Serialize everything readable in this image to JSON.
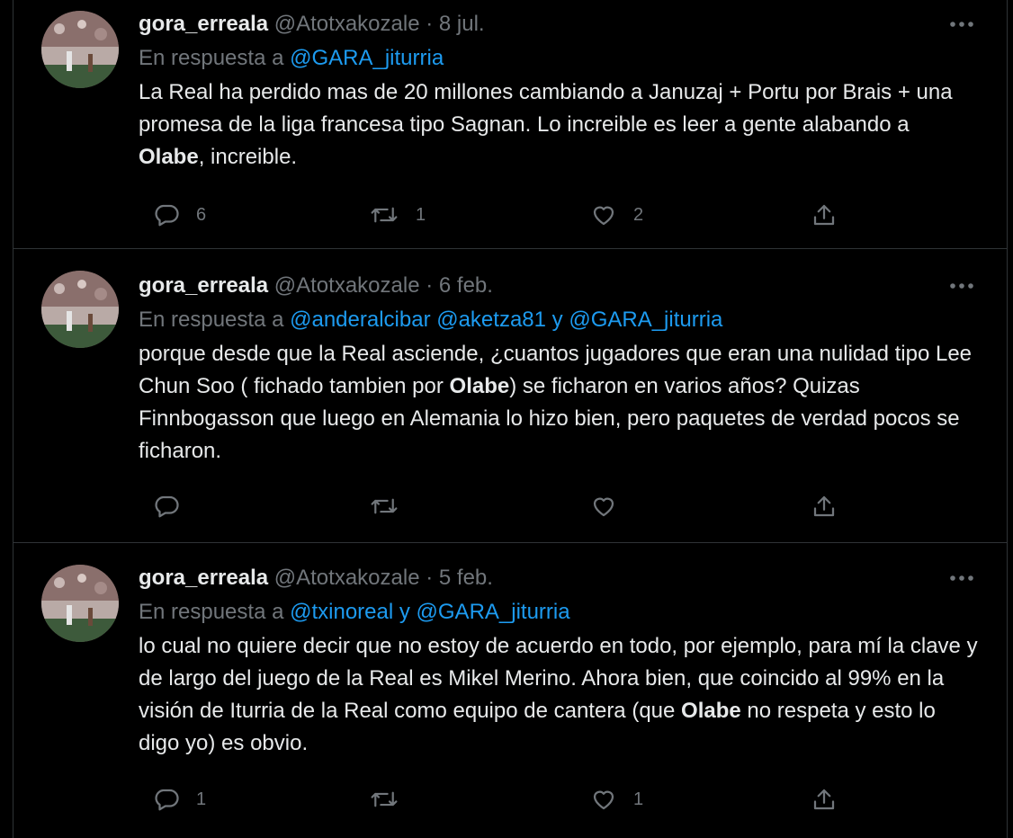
{
  "tweets": [
    {
      "display_name": "gora_erreala",
      "handle": "@Atotxakozale",
      "separator": "·",
      "date": "8 jul.",
      "reply_prefix": "En respuesta a",
      "reply_mentions": "@GARA_jiturria",
      "text_parts": [
        {
          "t": "La Real ha perdido mas de 20 millones cambiando a Januzaj + Portu por Brais + una promesa de la liga francesa tipo Sagnan. Lo increible es leer a gente alabando a ",
          "b": false
        },
        {
          "t": "Olabe",
          "b": true
        },
        {
          "t": ", increible.",
          "b": false
        }
      ],
      "reply_count": "6",
      "retweet_count": "1",
      "like_count": "2"
    },
    {
      "display_name": "gora_erreala",
      "handle": "@Atotxakozale",
      "separator": "·",
      "date": "6 feb.",
      "reply_prefix": "En respuesta a",
      "reply_mentions": "@anderalcibar @aketza81 y @GARA_jiturria",
      "text_parts": [
        {
          "t": "porque desde que la Real asciende, ¿cuantos jugadores que eran una nulidad tipo Lee Chun Soo ( fichado tambien por ",
          "b": false
        },
        {
          "t": "Olabe",
          "b": true
        },
        {
          "t": ") se ficharon en varios años? Quizas Finnbogasson que luego en Alemania lo hizo bien, pero paquetes de verdad pocos se ficharon.",
          "b": false
        }
      ],
      "reply_count": "",
      "retweet_count": "",
      "like_count": ""
    },
    {
      "display_name": "gora_erreala",
      "handle": "@Atotxakozale",
      "separator": "·",
      "date": "5 feb.",
      "reply_prefix": "En respuesta a",
      "reply_mentions": "@txinoreal y @GARA_jiturria",
      "text_parts": [
        {
          "t": "lo cual no quiere decir que no estoy de acuerdo en todo, por ejemplo, para mí la clave y de largo del juego de la Real es Mikel Merino. Ahora bien, que coincido al 99% en la visión de Iturria de la Real como equipo de cantera (que ",
          "b": false
        },
        {
          "t": "Olabe",
          "b": true
        },
        {
          "t": " no respeta y esto lo digo yo) es obvio.",
          "b": false
        }
      ],
      "reply_count": "1",
      "retweet_count": "",
      "like_count": "1"
    }
  ],
  "colors": {
    "background": "#000000",
    "text": "#e7e9ea",
    "secondary": "#71767b",
    "link": "#1d9bf0",
    "border": "#2f3336"
  },
  "icons": {
    "reply": "speech-bubble-icon",
    "retweet": "retweet-arrows-icon",
    "like": "heart-outline-icon",
    "share": "upload-share-icon",
    "more": "three-dots-icon"
  }
}
